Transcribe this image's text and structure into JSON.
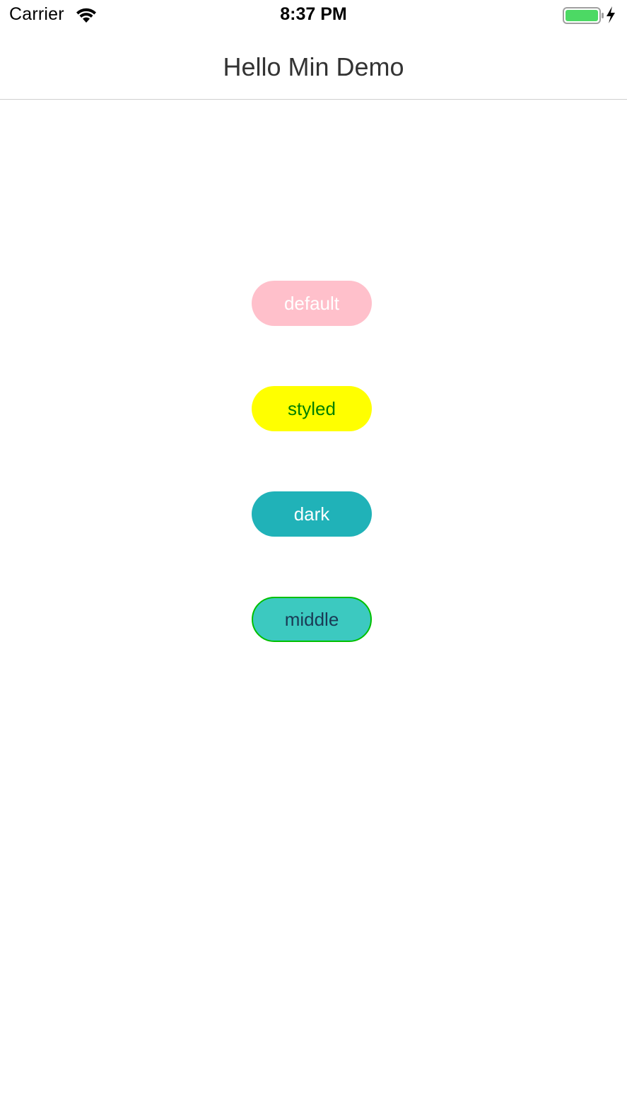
{
  "status_bar": {
    "carrier": "Carrier",
    "time": "8:37 PM",
    "wifi_icon": "wifi-icon",
    "battery_icon": "battery-icon",
    "charging_icon": "charging-bolt-icon",
    "battery_color": "#4cd964"
  },
  "nav": {
    "title": "Hello Min Demo"
  },
  "buttons": [
    {
      "label": "default",
      "background": "#ffc0cb",
      "text_color": "#ffffff"
    },
    {
      "label": "styled",
      "background": "#ffff00",
      "text_color": "#008000"
    },
    {
      "label": "dark",
      "background": "#20b2b8",
      "text_color": "#ffffff"
    },
    {
      "label": "middle",
      "background": "#3cc9c0",
      "text_color": "#1a3a55",
      "border_color": "#00c000"
    }
  ]
}
